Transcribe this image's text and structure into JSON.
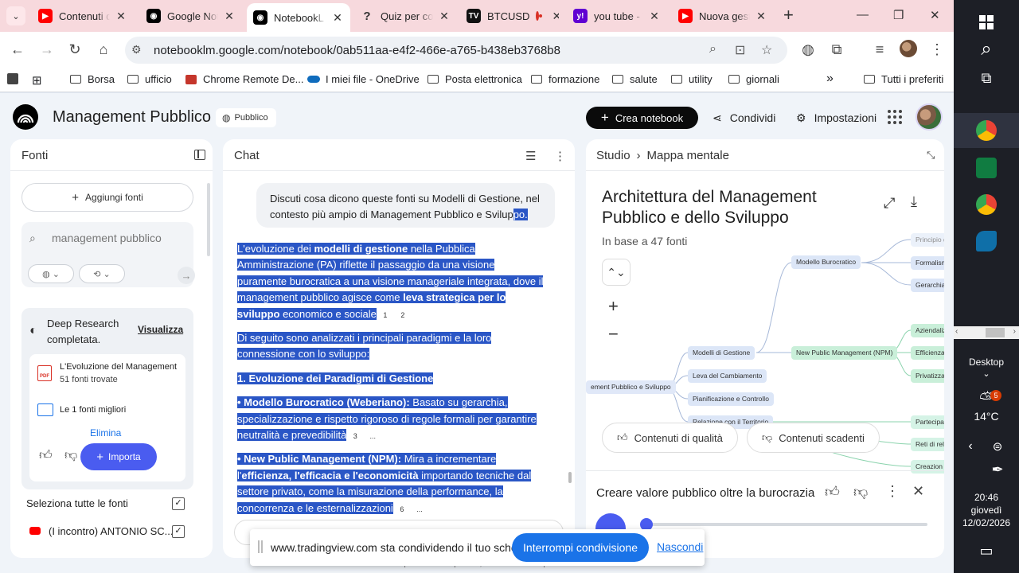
{
  "browser": {
    "tabs": [
      {
        "title": "Contenuti di ",
        "color": "#ff0000",
        "icon": "youtube-icon",
        "glyph": "▶"
      },
      {
        "title": "Google Not",
        "color": "#000000",
        "icon": "notebooklm-icon",
        "glyph": "◉"
      },
      {
        "title": "NotebookL",
        "color": "#000000",
        "icon": "notebooklm-icon",
        "glyph": "◉"
      },
      {
        "title": "Quiz per co",
        "color": "#444444",
        "icon": "question-icon",
        "glyph": "?"
      },
      {
        "title": "BTCUSD",
        "color": "#111111",
        "icon": "tradingview-icon",
        "glyph": "TV"
      },
      {
        "title": "you tube - Y",
        "color": "#6001d2",
        "icon": "yahoo-icon",
        "glyph": "y!"
      },
      {
        "title": "Nuova gest",
        "color": "#ff0000",
        "icon": "youtube-icon",
        "glyph": "▶"
      }
    ],
    "url": "notebooklm.google.com/notebook/0ab511aa-e4f2-466e-a765-b438eb3768b8",
    "bookmarks": [
      "Borsa",
      "ufficio",
      "Chrome Remote De...",
      "I miei file - OneDrive",
      "Posta elettronica",
      "formazione",
      "salute",
      "utility",
      "giornali"
    ],
    "all_bookmarks": "Tutti i preferiti"
  },
  "app": {
    "title": "Management Pubblico",
    "public_badge": "Pubblico",
    "create_notebook": "Crea notebook",
    "share": "Condividi",
    "settings": "Impostazioni"
  },
  "sources": {
    "title": "Fonti",
    "add": "Aggiungi fonti",
    "search_query": "management pubblico",
    "deep_research": "Deep Research completata.",
    "view": "Visualizza",
    "doc_title": "L'Evoluzione del Management",
    "doc_count": "51 fonti trovate",
    "best": "Le 1 fonti migliori",
    "delete": "Elimina",
    "import": "Importa",
    "select_all": "Seleziona tutte le fonti",
    "item": "(I incontro) ANTONIO SC..."
  },
  "chat": {
    "title": "Chat",
    "user_msg_1": "Discuti cosa dicono queste fonti su Modelli di Gestione, nel contesto più ampio di Management Pubblico e Svilup",
    "user_msg_hl": "po.",
    "p1_a": "L'evoluzione dei ",
    "p1_b": "modelli di gestione",
    "p1_c": " nella Pubblica Amministrazione (PA) riflette il passaggio da una visione puramente burocratica a una visione manageriale integrata, dove il management pubblico agisce come ",
    "p1_d": "leva strategica per lo sviluppo",
    "p1_e": " economico e sociale",
    "cite_1": "1",
    "cite_2": "2",
    "p2": "Di seguito sono analizzati i principali paradigmi e la loro connessione con lo sviluppo:",
    "h1": "1. Evoluzione dei Paradigmi di Gestione",
    "b1_a": "• Modello Burocratico (Weberiano):",
    "b1_b": " Basato su gerarchia, specializzazione e rispetto rigoroso di regole formali per garantire neutralità e prevedibilità",
    "cite_3": "3",
    "cite_more": "...",
    "b2_a": "• New Public Management (NPM):",
    "b2_b": " Mira a incrementare l'",
    "b2_c": "efficienza, l'efficacia e l'economicità",
    "b2_d": " importando tecniche dal settore privato, come la misurazione della performance, la concorrenza e le esternalizzazioni",
    "cite_6": "6"
  },
  "studio": {
    "crumb_1": "Studio",
    "crumb_2": "Mappa mentale",
    "title": "Architettura del Management Pubblico e dello Sviluppo",
    "subtitle": "In base a 47 fonti",
    "nodes": {
      "root": "ement Pubblico e Sviluppo",
      "modelli": "Modelli di Gestione",
      "leva": "Leva del Cambiamento",
      "pianif": "Pianificazione e Controllo",
      "relazione": "Relazione con il Territorio",
      "burocratico": "Modello Burocratico",
      "npm": "New Public Management (NPM)",
      "principio": "Principio di",
      "formalismo": "Formalismo",
      "gerarchia": "Gerarchia r",
      "aziendaliz": "Aziendaliz",
      "efficienza": "Efficienza e",
      "privatizz": "Privatizza",
      "partecipaz": "Partecipa",
      "reti": "Reti di relaz",
      "creazione": "Creazion"
    },
    "good_content": "Contenuti di qualità",
    "bad_content": "Contenuti scadenti",
    "audio_title": "Creare valore pubblico oltre la burocrazia",
    "disclaimer": "NotebookLM può essere impreciso; verifica le sue risposte."
  },
  "share_notice": {
    "message": "www.tradingview.com sta condividendo il tuo schermo.",
    "stop": "Interrompi condivisione",
    "hide": "Nascondi"
  },
  "taskbar": {
    "desktop": "Desktop",
    "temp": "14°C",
    "weather_badge": "5",
    "time": "20:46",
    "day": "giovedì",
    "date": "12/02/2026"
  }
}
